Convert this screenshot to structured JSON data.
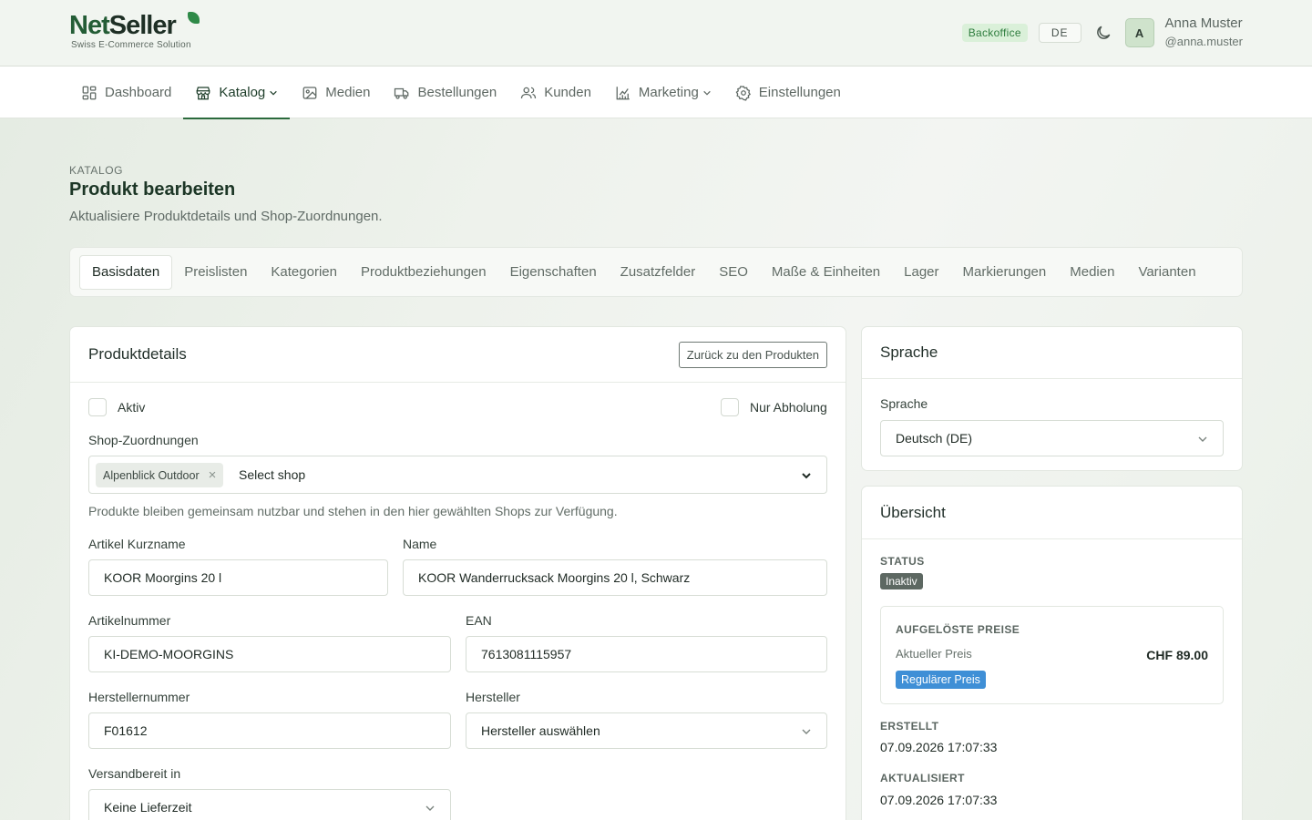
{
  "brand": {
    "name_part1": "Net",
    "name_part2": "Seller",
    "tagline": "Swiss E-Commerce Solution"
  },
  "header": {
    "env_badge": "Backoffice",
    "language": "DE",
    "avatar_letter": "A",
    "user_name": "Anna Muster",
    "user_handle": "@anna.muster"
  },
  "nav": {
    "items": [
      {
        "label": "Dashboard",
        "icon": "dashboard-icon"
      },
      {
        "label": "Katalog",
        "icon": "store-icon",
        "active": true,
        "dropdown": true
      },
      {
        "label": "Medien",
        "icon": "image-icon"
      },
      {
        "label": "Bestellungen",
        "icon": "truck-icon"
      },
      {
        "label": "Kunden",
        "icon": "users-icon"
      },
      {
        "label": "Marketing",
        "icon": "chart-icon",
        "dropdown": true
      },
      {
        "label": "Einstellungen",
        "icon": "gear-icon"
      }
    ]
  },
  "page": {
    "breadcrumb": "KATALOG",
    "title": "Produkt bearbeiten",
    "subtitle": "Aktualisiere Produktdetails und Shop-Zuordnungen."
  },
  "tabs": [
    "Basisdaten",
    "Preislisten",
    "Kategorien",
    "Produktbeziehungen",
    "Eigenschaften",
    "Zusatzfelder",
    "SEO",
    "Maße & Einheiten",
    "Lager",
    "Markierungen",
    "Medien",
    "Varianten"
  ],
  "details": {
    "title": "Produktdetails",
    "back_button": "Zurück zu den Produkten",
    "active_label": "Aktiv",
    "pickup_label": "Nur Abholung",
    "shops_label": "Shop-Zuordnungen",
    "shop_chip": "Alpenblick Outdoor",
    "shop_placeholder": "Select shop",
    "shops_help": "Produkte bleiben gemeinsam nutzbar und stehen in den hier gewählten Shops zur Verfügung.",
    "short_name_label": "Artikel Kurzname",
    "short_name_value": "KOOR Moorgins 20 l",
    "name_label": "Name",
    "name_value": "KOOR Wanderrucksack Moorgins 20 l, Schwarz",
    "sku_label": "Artikelnummer",
    "sku_value": "KI-DEMO-MOORGINS",
    "ean_label": "EAN",
    "ean_value": "7613081115957",
    "mpn_label": "Herstellernummer",
    "mpn_value": "F01612",
    "manufacturer_label": "Hersteller",
    "manufacturer_value": "Hersteller auswählen",
    "shipping_label": "Versandbereit in",
    "shipping_value": "Keine Lieferzeit"
  },
  "language_card": {
    "title": "Sprache",
    "label": "Sprache",
    "value": "Deutsch (DE)"
  },
  "overview": {
    "title": "Übersicht",
    "status_label": "STATUS",
    "status_value": "Inaktiv",
    "prices_label": "AUFGELÖSTE PREISE",
    "current_price_label": "Aktueller Preis",
    "current_price_value": "CHF 89.00",
    "price_badge": "Regulärer Preis",
    "created_label": "ERSTELLT",
    "created_value": "07.09.2026 17:07:33",
    "updated_label": "AKTUALISIERT",
    "updated_value": "07.09.2026 17:07:33"
  }
}
